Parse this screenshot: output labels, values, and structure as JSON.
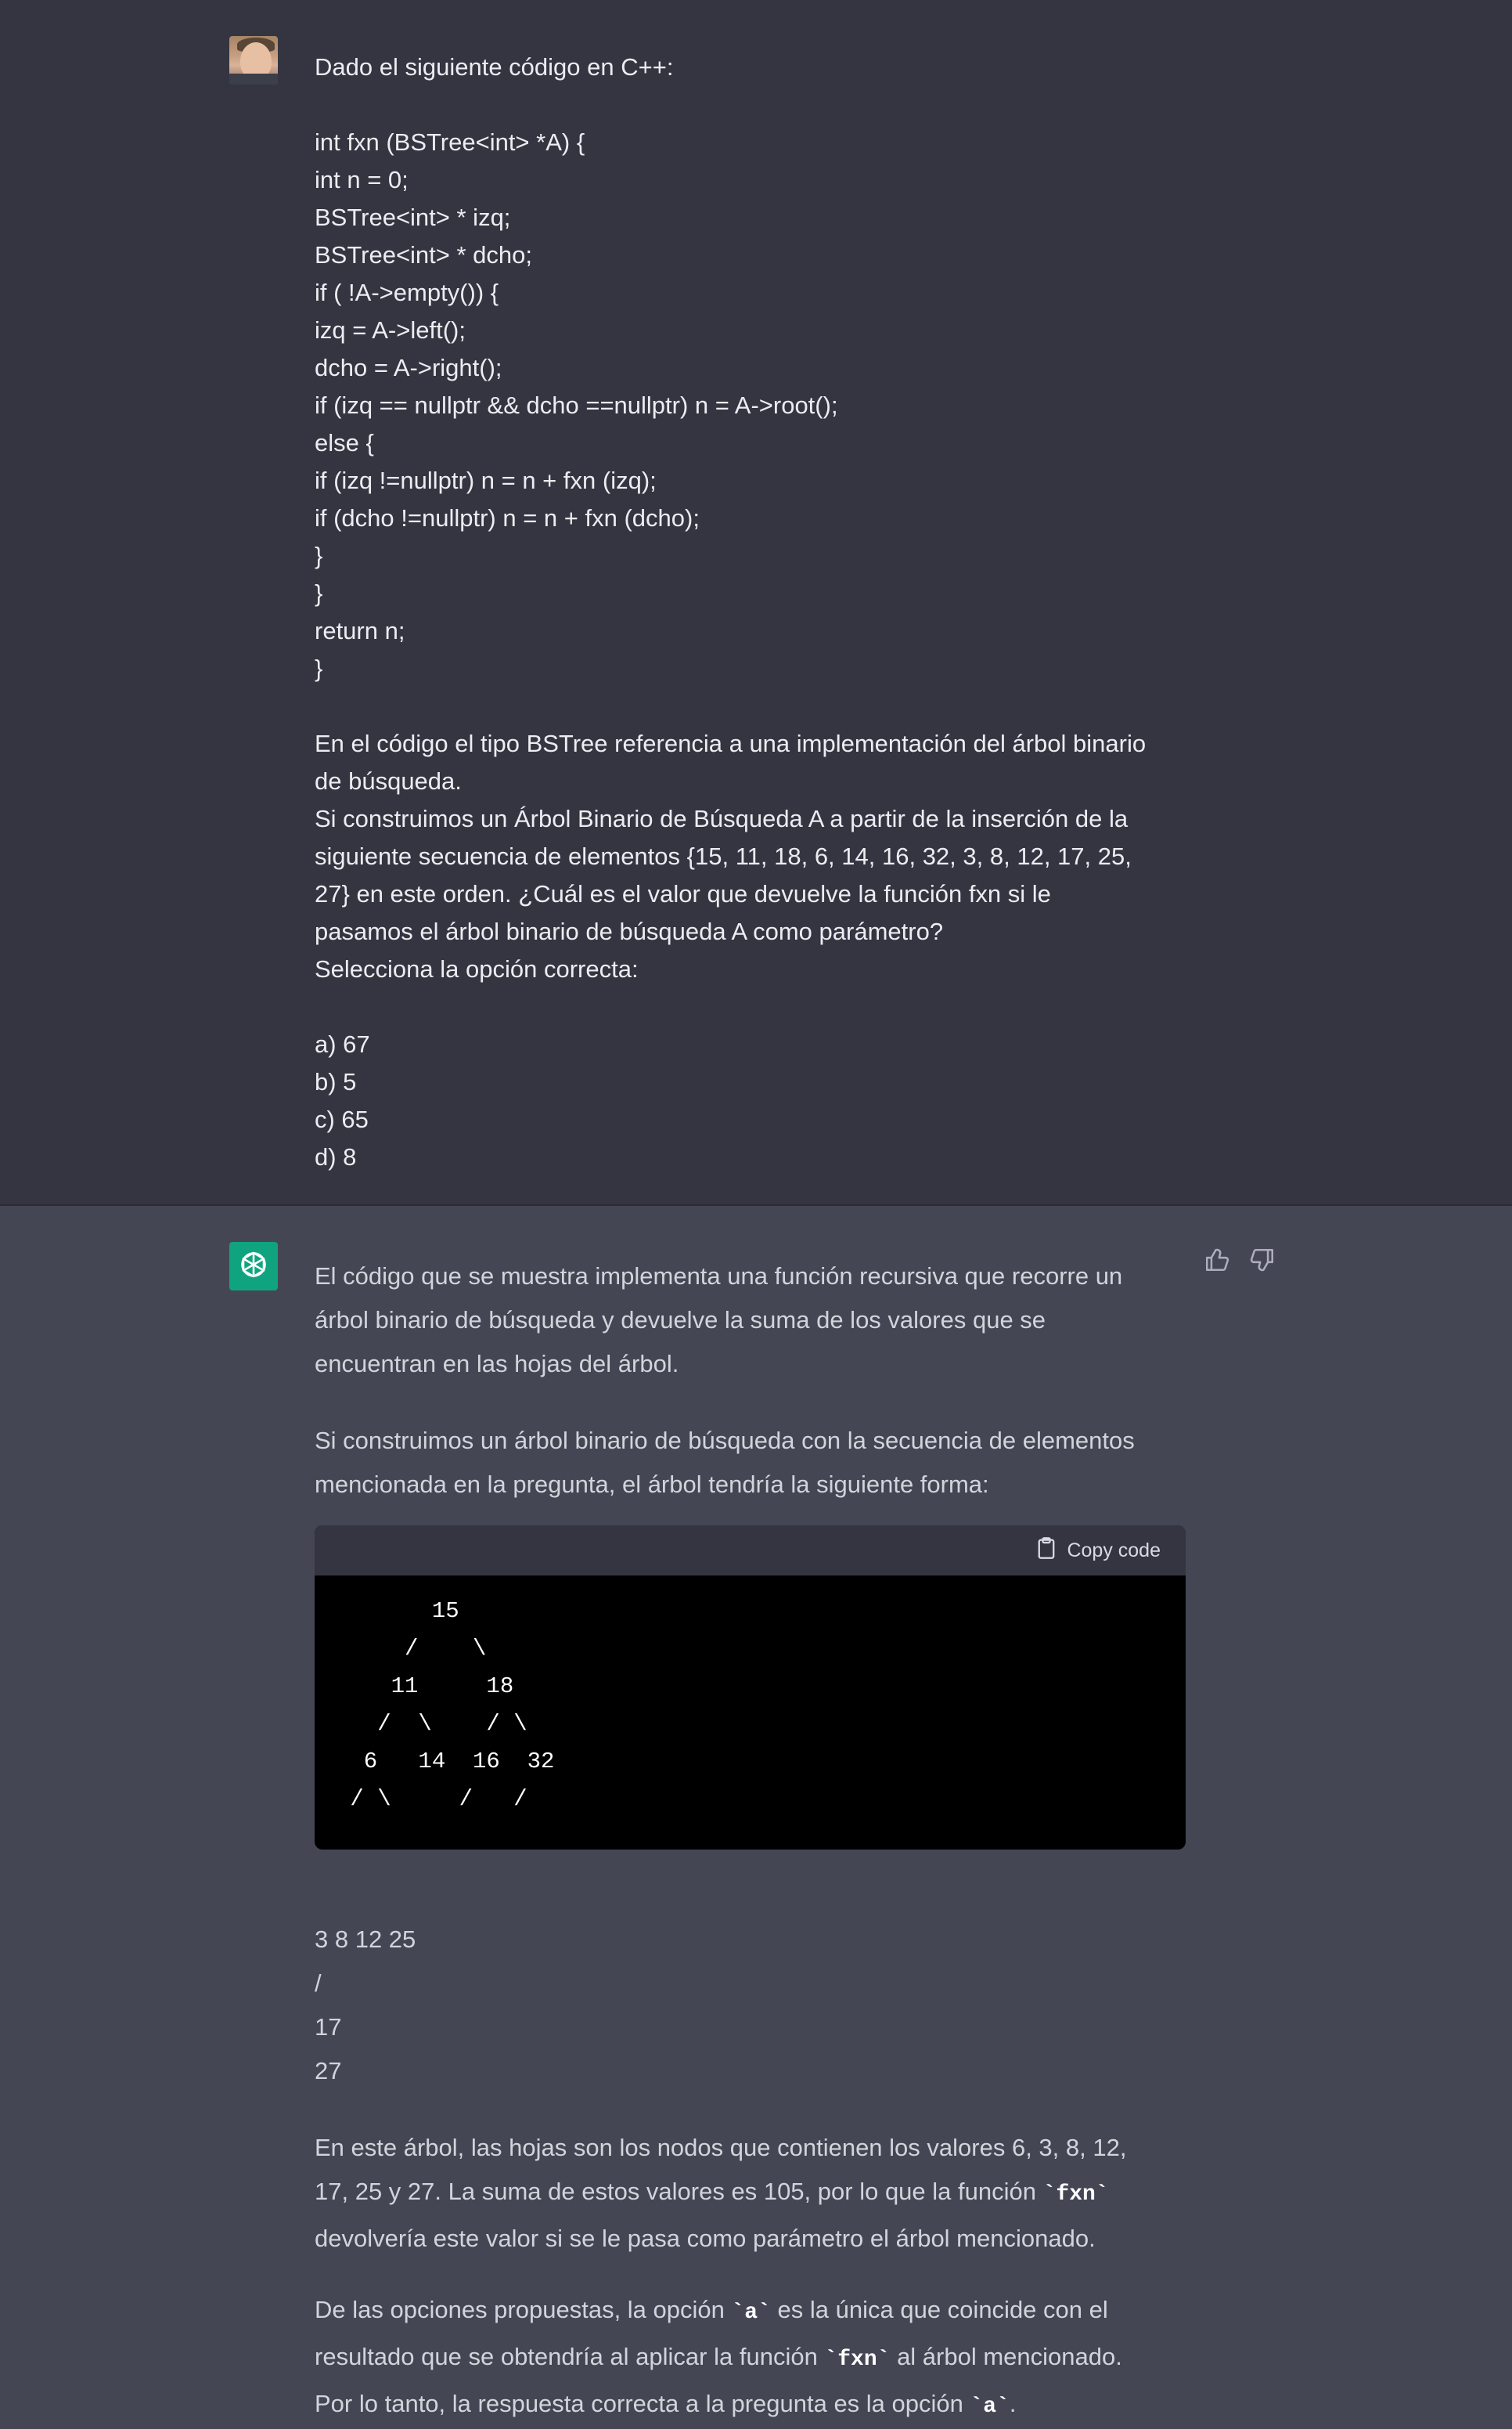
{
  "user_message": {
    "lines": [
      "Dado el siguiente código en C++:",
      "",
      "int fxn (BSTree<int> *A) {",
      "int n = 0;",
      "BSTree<int> * izq;",
      "BSTree<int> * dcho;",
      "if ( !A->empty()) {",
      "izq = A->left();",
      "dcho = A->right();",
      "if (izq == nullptr && dcho ==nullptr) n = A->root();",
      "else {",
      "if (izq !=nullptr) n = n + fxn (izq);",
      "if (dcho !=nullptr) n = n + fxn (dcho);",
      "}",
      "}",
      "return n;",
      "}",
      "",
      "En el código el tipo BSTree referencia a una implementación del árbol binario",
      "de búsqueda.",
      "Si construimos un Árbol Binario de Búsqueda A a partir de la inserción de la",
      "siguiente secuencia de elementos {15, 11, 18, 6, 14, 16, 32, 3, 8, 12, 17, 25,",
      "27} en este orden. ¿Cuál es el valor que devuelve la función fxn si le",
      "pasamos el árbol binario de búsqueda A como parámetro?",
      "Selecciona la opción correcta:",
      "",
      "a) 67",
      "b) 5",
      "c) 65",
      "d) 8"
    ]
  },
  "assistant_message": {
    "intro_paragraph": [
      "El código que se muestra implementa una función recursiva que recorre un",
      "árbol binario de búsqueda y devuelve la suma de los valores que se",
      "encuentran en las hojas del árbol."
    ],
    "tree_paragraph": [
      "Si construimos un árbol binario de búsqueda con la secuencia de elementos",
      "mencionada en la pregunta, el árbol tendría la siguiente forma:"
    ],
    "code_block": {
      "copy_label": "Copy code",
      "lines": [
        "       15",
        "     /    \\",
        "    11     18",
        "   /  \\    / \\",
        "  6   14  16  32",
        " / \\     /   /"
      ]
    },
    "after_code_lines": [
      "3 8 12 25",
      "/",
      "17",
      "27"
    ],
    "leaves_paragraph": {
      "line1": "En este árbol, las hojas son los nodos que contienen los valores 6, 3, 8, 12,",
      "line2_pre": "17, 25 y 27. La suma de estos valores es 105, por lo que la función ",
      "line2_code": "`fxn`",
      "line3": "devolvería este valor si se le pasa como parámetro el árbol mencionado."
    },
    "options_paragraph": {
      "line1_pre": "De las opciones propuestas, la opción ",
      "line1_code": "`a`",
      "line1_post": " es la única que coincide con el",
      "line2_pre": "resultado que se obtendría al aplicar la función ",
      "line2_code": "`fxn`",
      "line2_post": " al árbol mencionado.",
      "line3_pre": "Por lo tanto, la respuesta correcta a la pregunta es la opción ",
      "line3_code": "`a`",
      "line3_post": "."
    }
  },
  "icons": {
    "user_avatar": "user-avatar-photo",
    "bot_avatar": "openai-logo-icon",
    "thumbs_up": "thumbs-up-icon",
    "thumbs_down": "thumbs-down-icon",
    "copy": "clipboard-icon"
  },
  "colors": {
    "user_bg": "#343541",
    "assistant_bg": "#444654",
    "bot_accent": "#10a37f",
    "code_bg": "#000000",
    "code_header_bg": "#343541"
  }
}
